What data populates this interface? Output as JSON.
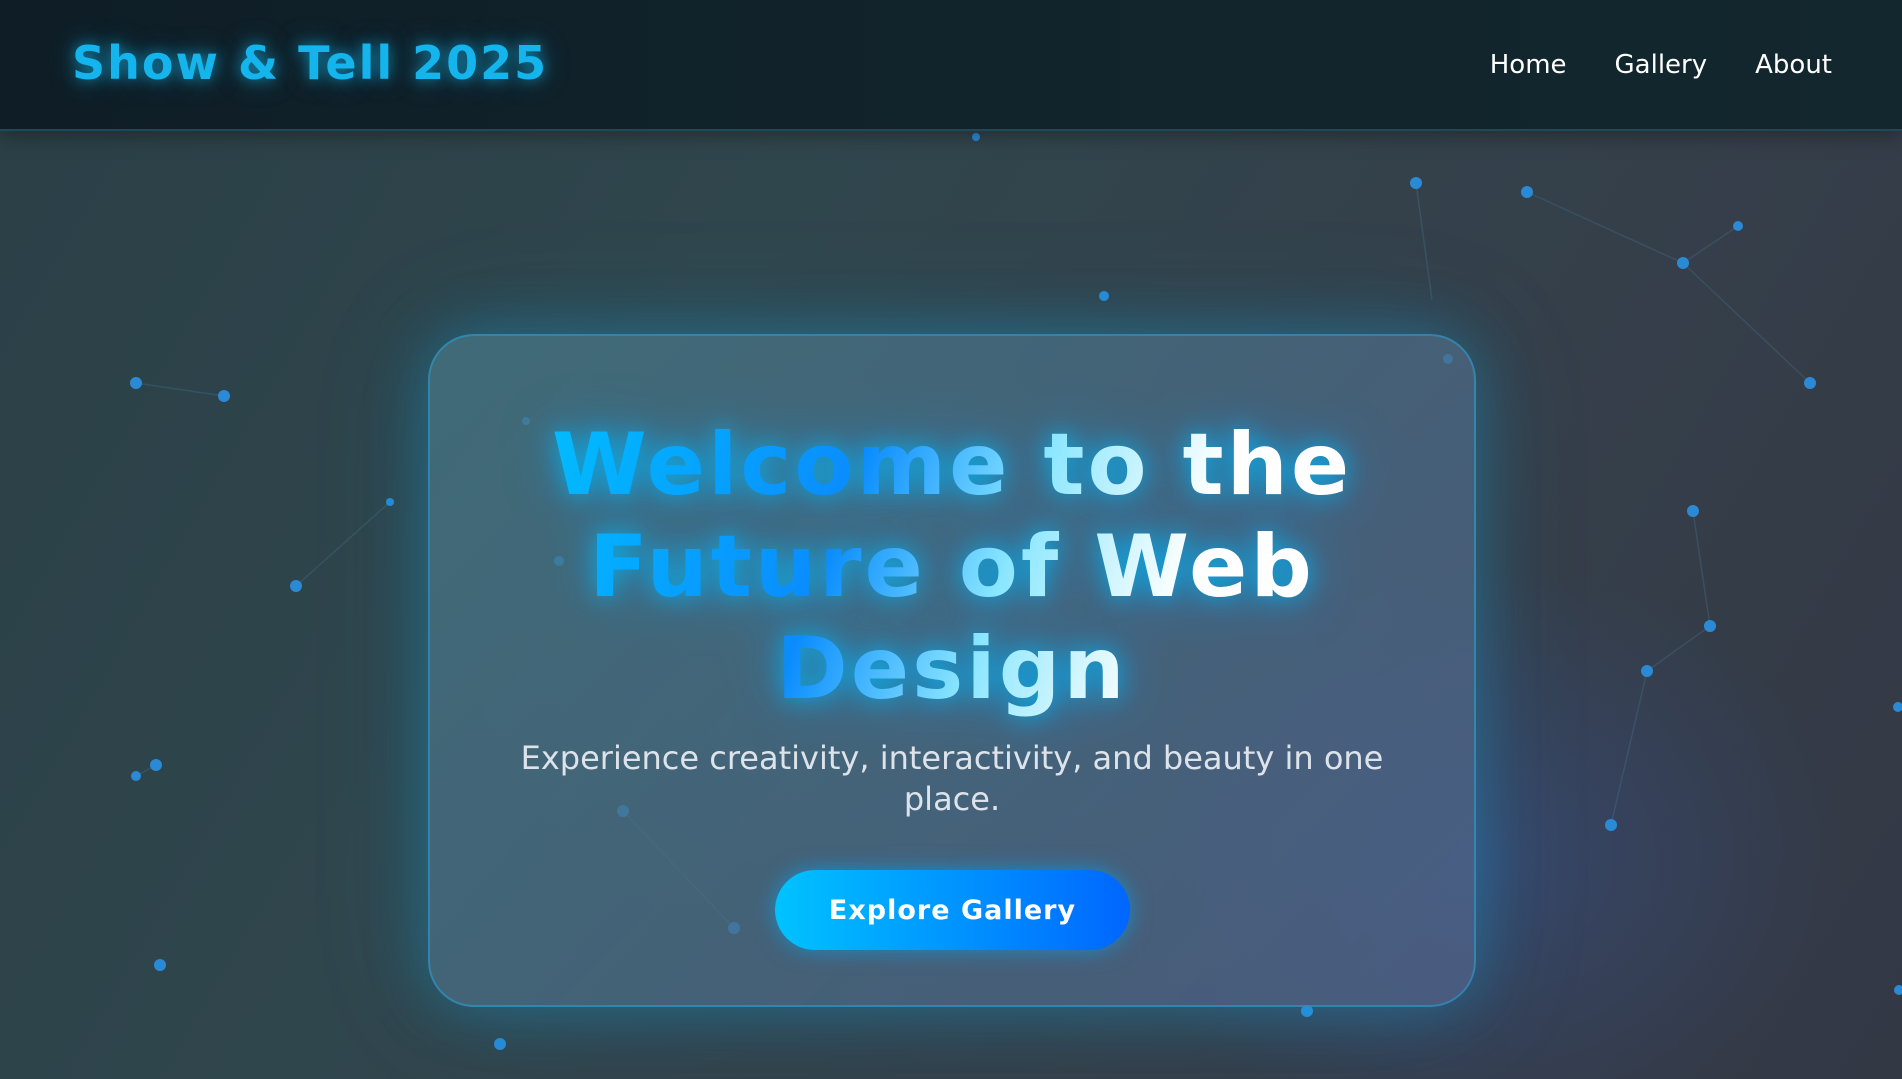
{
  "header": {
    "logo": "Show & Tell 2025",
    "nav": [
      "Home",
      "Gallery",
      "About"
    ]
  },
  "hero": {
    "title": "Welcome to the Future of Web Design",
    "subtitle": "Experience creativity, interactivity, and beauty in one place.",
    "cta_label": "Explore Gallery"
  },
  "colors": {
    "accent": "#14b4ec",
    "cta_start": "#00c3ff",
    "cta_end": "#0066ff",
    "header_bg": "#11232b",
    "particle": "#2a8ad6"
  }
}
